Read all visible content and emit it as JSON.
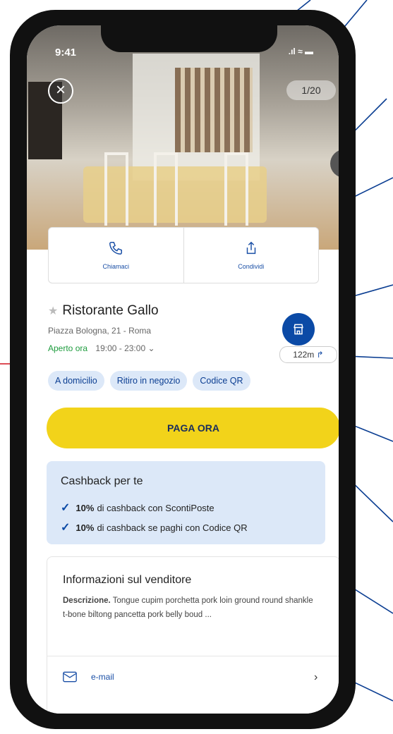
{
  "status": {
    "time": "9:41",
    "indicators": ".ıl ≈ ▬"
  },
  "gallery": {
    "counter": "1/20"
  },
  "actions": [
    {
      "label": "Chiamaci",
      "icon": "phone-icon"
    },
    {
      "label": "Condividi",
      "icon": "share-icon"
    }
  ],
  "store": {
    "name": "Ristorante Gallo",
    "address": "Piazza Bologna, 21 - Roma",
    "open_label": "Aperto ora",
    "hours": "19:00 - 23:00",
    "distance": "122m"
  },
  "chips": [
    "A domicilio",
    "Ritiro in negozio",
    "Codice QR"
  ],
  "pay_button": "PAGA ORA",
  "cashback": {
    "title": "Cashback per te",
    "items": [
      {
        "percent": "10%",
        "text": "di cashback con ScontiPoste"
      },
      {
        "percent": "10%",
        "text": "di cashback se paghi con Codice QR"
      }
    ]
  },
  "seller": {
    "title": "Informazioni sul venditore",
    "desc_label": "Descrizione.",
    "desc": "Tongue cupim porchetta pork loin ground round shankle t-bone biltong pancetta pork belly boud ...",
    "email_label": "e-mail"
  },
  "colors": {
    "brand_blue": "#0b4aa6",
    "pay_yellow": "#f2d31a",
    "open_green": "#1e9c3e",
    "annotation_line": "#0b3e92",
    "annotation_arrow": "#d0141e"
  }
}
